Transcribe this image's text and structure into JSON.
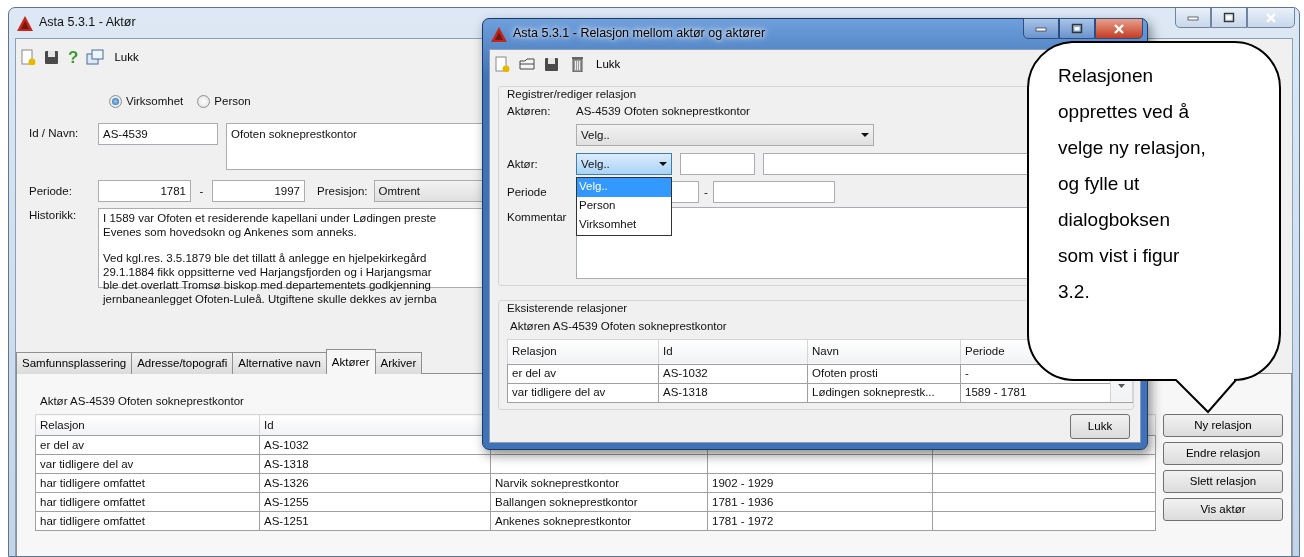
{
  "main_window": {
    "title": "Asta 5.3.1 - Aktør",
    "toolbar": {
      "help": "?",
      "close": "Lukk"
    },
    "type_options": [
      {
        "label": "Virksomhet",
        "selected": true
      },
      {
        "label": "Person",
        "selected": false
      }
    ],
    "id_label": "Id / Navn:",
    "id": "AS-4539",
    "name": "Ofoten sokneprestkontor",
    "period_label": "Periode:",
    "period_from": "1781",
    "period_separator": "-",
    "period_to": "1997",
    "precision_label": "Presisjon:",
    "precision": "Omtrent",
    "history_label": "Historikk:",
    "history_paragraphs": [
      [
        "I 1589 var Ofoten et residerende kapellani under Lødingen preste",
        "Evenes som hovedsokn og Ankenes som anneks."
      ],
      [
        "Ved kgl.res. 3.5.1879 ble det tillatt å anlegge en hjelpekirkegård",
        "29.1.1884 fikk oppsitterne ved Harjangsfjorden og i Harjangsmar",
        "ble det overlatt Tromsø biskop med departementets godkjenning",
        "jernbaneanlegget Ofoten-Luleå. Utgiftene skulle dekkes av jernba"
      ]
    ],
    "tabs": [
      {
        "label": "Samfunnsplassering",
        "selected": false
      },
      {
        "label": "Adresse/topografi",
        "selected": false
      },
      {
        "label": "Alternative navn",
        "selected": false
      },
      {
        "label": "Aktører",
        "selected": true
      },
      {
        "label": "Arkiver",
        "selected": false
      }
    ],
    "actor_caption": "Aktør AS-4539 Ofoten sokneprestkontor",
    "table": {
      "columns": [
        "Relasjon",
        "Id"
      ],
      "rows": [
        {
          "cells": [
            "er del av",
            "AS-1032"
          ]
        },
        {
          "cells": [
            "var tidligere del av",
            "AS-1318"
          ]
        },
        {
          "cells": [
            "har tidligere omfattet",
            "AS-1326",
            "Narvik sokneprestkontor",
            "1902 - 1929"
          ]
        },
        {
          "cells": [
            "har tidligere omfattet",
            "AS-1255",
            "Ballangen sokneprestkontor",
            "1781 - 1936"
          ]
        },
        {
          "cells": [
            "har tidligere omfattet",
            "AS-1251",
            "Ankenes sokneprestkontor",
            "1781 - 1972"
          ]
        }
      ]
    },
    "buttons": [
      "Ny relasjon",
      "Endre relasjon",
      "Slett relasjon",
      "Vis aktør"
    ]
  },
  "dialog": {
    "title": "Asta 5.3.1 - Relasjon mellom aktør og aktører",
    "toolbar": {
      "close": "Lukk"
    },
    "edit_group": {
      "legend": "Registrer/rediger relasjon",
      "actor_label": "Aktøren:",
      "actor_value": "AS-4539 Ofoten sokneprestkontor",
      "relation_select": "Velg..",
      "other_actor_label": "Aktør:",
      "type_select": {
        "value": "Velg..",
        "expanded": true,
        "options": [
          {
            "label": "Velg..",
            "selected": true
          },
          {
            "label": "Person",
            "selected": false
          },
          {
            "label": "Virksomhet",
            "selected": false
          }
        ]
      },
      "period_label": "Periode",
      "period_separator": "-",
      "comment_label": "Kommentar"
    },
    "existing_group": {
      "legend": "Eksisterende relasjoner",
      "caption": "Aktøren AS-4539 Ofoten sokneprestkontor",
      "table": {
        "columns": [
          "Relasjon",
          "Id",
          "Navn",
          "Periode"
        ],
        "rows": [
          {
            "cells": [
              "er del av",
              "AS-1032",
              "Ofoten prosti",
              "-"
            ]
          },
          {
            "cells": [
              "var tidligere del av",
              "AS-1318",
              "Lødingen sokneprestk...",
              "1589 - 1781"
            ]
          }
        ]
      }
    },
    "close_button": "Lukk"
  },
  "callout": {
    "text": "Relasjonen opprettes ved å velge ny relasjon, og fylle ut dialogboksen som vist i figur 3.2."
  }
}
